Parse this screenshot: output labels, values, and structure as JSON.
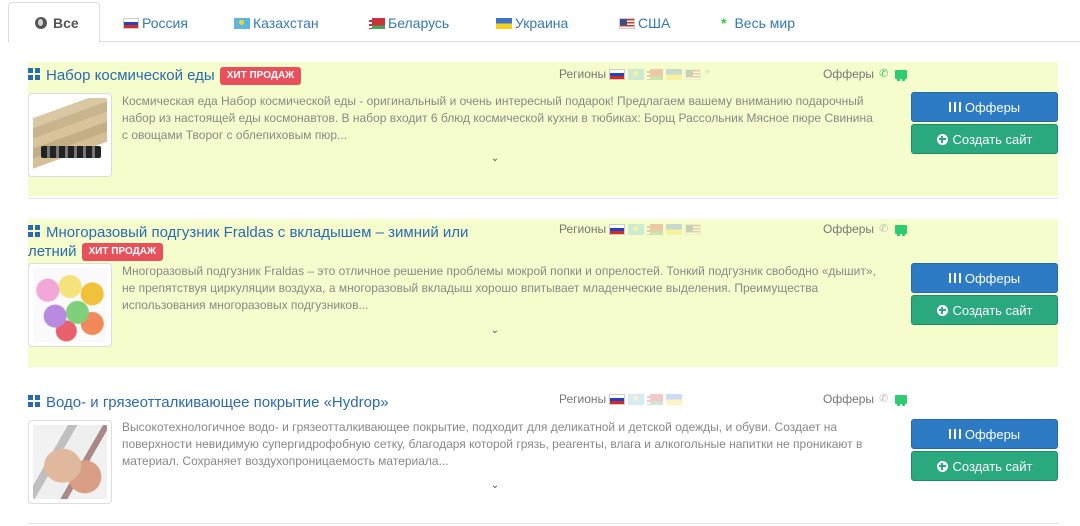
{
  "tabs": [
    {
      "label": "Все",
      "icon": "globe-icon",
      "active": true
    },
    {
      "label": "Россия",
      "icon": "flag-ru-icon"
    },
    {
      "label": "Казахстан",
      "icon": "flag-kz-icon"
    },
    {
      "label": "Беларусь",
      "icon": "flag-by-icon"
    },
    {
      "label": "Украина",
      "icon": "flag-ua-icon"
    },
    {
      "label": "США",
      "icon": "flag-us-icon"
    },
    {
      "label": "Весь мир",
      "icon": "star-icon"
    }
  ],
  "labels": {
    "regions": "Регионы",
    "offers": "Офферы",
    "offers_button": "Офферы",
    "create_site_button": "Создать сайт",
    "hit_badge": "ХИТ ПРОДАЖ"
  },
  "products": [
    {
      "title": "Набор космической еды",
      "hit": true,
      "description": "Космическая еда Набор космической еды - оригинальный и очень интересный подарок! Предлагаем вашему вниманию подарочный набор из настоящей еды космонавтов. В набор входит 6 блюд космической кухни в тюбиках: Борщ Рассольник Мясное пюре Свинина с овощами Творог с облепиховым пюр...",
      "phone_active": true,
      "delivery_active": true
    },
    {
      "title": "Многоразовый подгузник Fraldas с вкладышем – зимний или летний",
      "hit": true,
      "description": "Многоразовый подгузник Fraldas – это отличное решение проблемы мокрой попки и опрелостей. Тонкий подгузник свободно «дышит», не препятствуя циркуляции воздуха, а многоразовый вкладыш хорошо впитывает младенческие выделения. Преимущества использования многоразовых подгузников...",
      "phone_active": false,
      "delivery_active": true
    },
    {
      "title": "Водо- и грязеотталкивающее покрытие «Hydrop»",
      "hit": false,
      "description": "Высокотехнологичное водо- и грязеотталкивающее покрытие, подходит для деликатной и детской одежды, и обуви. Создает на поверхности невидимую супергидрофобную сетку, благодаря которой грязь, реагенты, влага и алкогольные напитки не проникают в материал. Сохраняет воздухопроницаемость материала...",
      "phone_active": false,
      "delivery_active": true
    }
  ],
  "colors": {
    "highlight": "#f5fdcc",
    "link": "#2a6bb0",
    "badge": "#e8505b",
    "btn_blue": "#2d7bc4",
    "btn_green": "#2aa87e"
  }
}
